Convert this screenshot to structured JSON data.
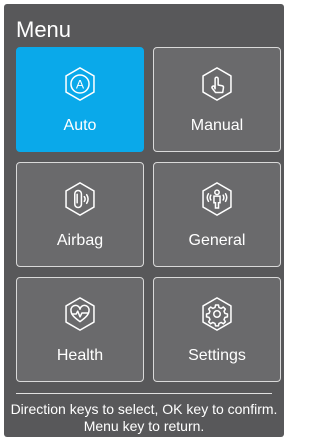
{
  "menu": {
    "title": "Menu",
    "tiles": [
      {
        "label": "Auto",
        "icon": "auto-icon",
        "selected": true
      },
      {
        "label": "Manual",
        "icon": "hand-touch-icon",
        "selected": false
      },
      {
        "label": "Airbag",
        "icon": "airbag-icon",
        "selected": false
      },
      {
        "label": "General",
        "icon": "person-massage-icon",
        "selected": false
      },
      {
        "label": "Health",
        "icon": "heart-pulse-icon",
        "selected": false
      },
      {
        "label": "Settings",
        "icon": "gear-icon",
        "selected": false
      }
    ],
    "hint": "Direction keys to select, OK key to confirm. Menu key to return."
  },
  "colors": {
    "background": "#58585a",
    "selected": "#0aa9ea",
    "tile": "#6a6a6c",
    "border": "#d9d9d9"
  }
}
